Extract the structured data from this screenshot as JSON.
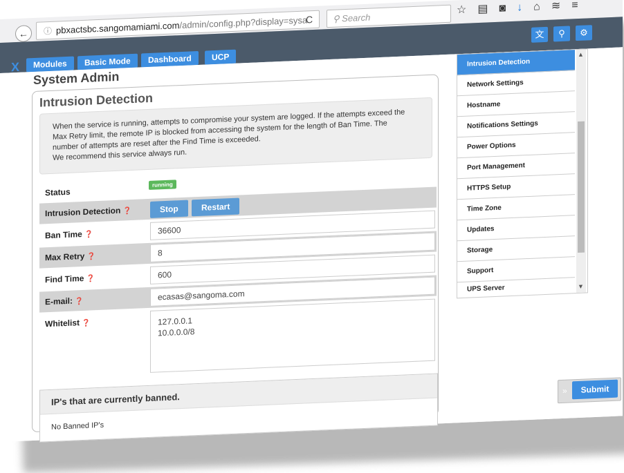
{
  "browser": {
    "url_host": "pbxactsbc.sangomamiami.com",
    "url_path": "/admin/config.php?display=sysa",
    "search_placeholder": "Search",
    "reload_glyph": "C",
    "icons": [
      "star-icon",
      "clipboard-icon",
      "pocket-icon",
      "download-icon",
      "home-icon",
      "layers-icon",
      "menu-icon"
    ]
  },
  "nav": {
    "logo": "X",
    "tabs": [
      "Modules",
      "Basic Mode",
      "Dashboard",
      "UCP"
    ],
    "tools": [
      "language-icon",
      "search-icon",
      "gear-icon"
    ]
  },
  "page": {
    "title": "System Admin",
    "section_title": "Intrusion Detection",
    "description_lines": [
      "When the service is running, attempts to compromise your system are logged. If the attempts exceed the",
      "Max Retry limit, the remote IP is blocked from accessing the system for the length of Ban Time. The",
      "number of attempts are reset after the Find Time is exceeded.",
      "We recommend this service always run."
    ]
  },
  "form": {
    "status_label": "Status",
    "status_value": "running",
    "intrusion_label": "Intrusion Detection",
    "stop_label": "Stop",
    "restart_label": "Restart",
    "ban_time_label": "Ban Time",
    "ban_time_value": "36600",
    "max_retry_label": "Max Retry",
    "max_retry_value": "8",
    "find_time_label": "Find Time",
    "find_time_value": "600",
    "email_label": "E-mail:",
    "email_value": "ecasas@sangoma.com",
    "whitelist_label": "Whitelist",
    "whitelist_values": [
      "127.0.0.1",
      "10.0.0.0/8"
    ],
    "help_glyph": "❓"
  },
  "banned": {
    "header": "IP's that are currently banned.",
    "body": "No Banned IP's"
  },
  "sidemenu": {
    "items": [
      "Intrusion Detection",
      "Network Settings",
      "Hostname",
      "Notifications Settings",
      "Power Options",
      "Port Management",
      "HTTPS Setup",
      "Time Zone",
      "Updates",
      "Storage",
      "Support",
      "UPS Server"
    ],
    "active_index": 0
  },
  "submit": {
    "label": "Submit",
    "chev": "»"
  },
  "colors": {
    "accent": "#3d8ee0",
    "navbar": "#4b5a6a",
    "running": "#5cb85c",
    "action": "#5b9bd5"
  }
}
